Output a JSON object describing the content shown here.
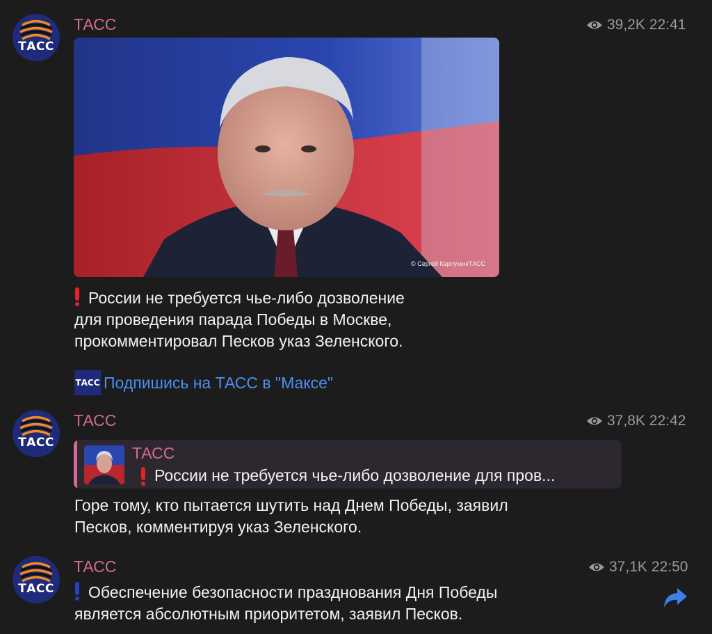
{
  "messages": [
    {
      "sender": "ТАСС",
      "views": "39,2K",
      "time": "22:41",
      "photo_credit": "© Сергей Карпухин/ТАСС",
      "text_lines": [
        "России не требуется чье-либо дозволение",
        "для проведения парада Победы в Москве,",
        "прокомментировал Песков указ Зеленского."
      ],
      "subscribe_link": "Подпишись на ТАСС в \"Максе\""
    },
    {
      "sender": "ТАСС",
      "views": "37,8K",
      "time": "22:42",
      "reply": {
        "sender": "ТАСС",
        "text": "России не требуется чье-либо дозволение для пров..."
      },
      "text_lines": [
        "Горе тому, кто пытается шутить над Днем Победы, заявил",
        "Песков, комментируя указ Зеленского."
      ]
    },
    {
      "sender": "ТАСС",
      "views": "37,1K",
      "time": "22:50",
      "text_lines": [
        "Обеспечение безопасности празднования Дня Победы",
        "является абсолютным приоритетом, заявил Песков."
      ]
    }
  ],
  "avatar_text": "ТАСС",
  "mini_logo_text": "ТАСС",
  "icons": {
    "views": "eye-icon",
    "share": "share-arrow-icon",
    "exclamation_red": "red-exclamation-icon",
    "exclamation_blue": "blue-exclamation-icon"
  },
  "colors": {
    "sender": "#d36b95",
    "link": "#4b8ff0",
    "meta": "#9a9a9f",
    "background": "#1c1c1d",
    "excl_red": "#e0242a",
    "excl_blue": "#2a3ec7",
    "share": "#3d7fe8"
  }
}
